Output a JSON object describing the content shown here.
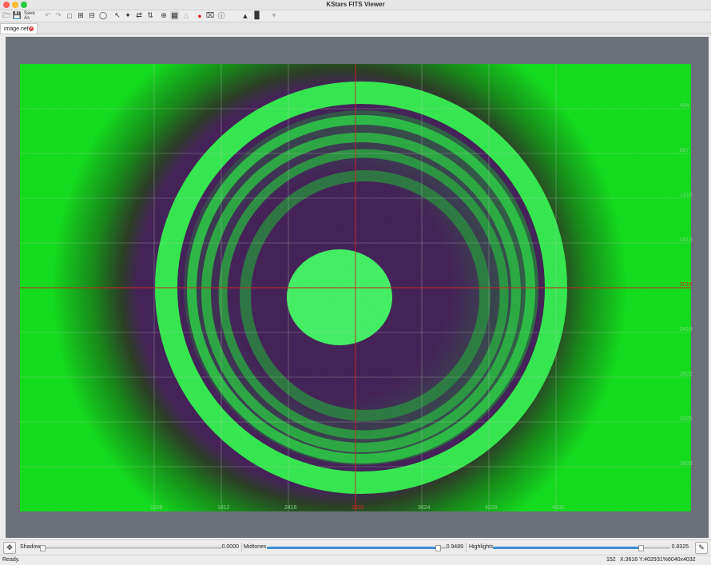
{
  "window": {
    "title": "KStars FITS Viewer"
  },
  "toolbar": {
    "open_icon": "folder-open-icon",
    "save_icon": "save-icon",
    "save_as_label": "Save As",
    "undo_icon": "undo-icon",
    "redo_icon": "redo-icon",
    "zoom_fit_icon": "zoom-fit-icon",
    "zoom_in_icon": "zoom-in-icon",
    "zoom_out_icon": "zoom-out-icon",
    "zoom_default_icon": "zoom-default-icon",
    "crosshair_icon": "crosshair-icon",
    "grid_icon": "grid-icon",
    "record_icon": "record-icon",
    "info_icon": "info-icon",
    "histogram_icon": "histogram-icon",
    "stats_icon": "stats-icon"
  },
  "tabs": [
    {
      "label": "image.nef",
      "active": true
    }
  ],
  "image": {
    "y_labels": [
      "404",
      "807",
      "1210",
      "1613",
      "2016",
      "2419",
      "2822",
      "3225",
      "3628"
    ],
    "y_highlight": "2016",
    "x_labels": [
      "1208",
      "1812",
      "2416",
      "3020",
      "3624",
      "4228",
      "4832"
    ],
    "x_highlight": "3020",
    "background_color": "#0bdc16",
    "ring_color": "#2fe84a",
    "dark_color": "#3e1b53",
    "core_color": "#3ef060",
    "crosshair_color": "#d22222"
  },
  "sliders": {
    "shadows_label": "Shadows",
    "shadows_value": "0.0000",
    "shadows_level": 0.0,
    "midtones_label": "Midtones",
    "midtones_value": "0.9489",
    "midtones_level": 0.9489,
    "highlights_label": "Highlights",
    "highlights_value": "0.8325",
    "highlights_level": 0.8325,
    "left_tool_icon": "move-icon",
    "right_tool_icon": "edit-icon"
  },
  "status": {
    "message": "Ready.",
    "value": "152",
    "coords": "X:3616 Y:4029",
    "zoom": "31%",
    "dimensions": "6040x4032"
  }
}
